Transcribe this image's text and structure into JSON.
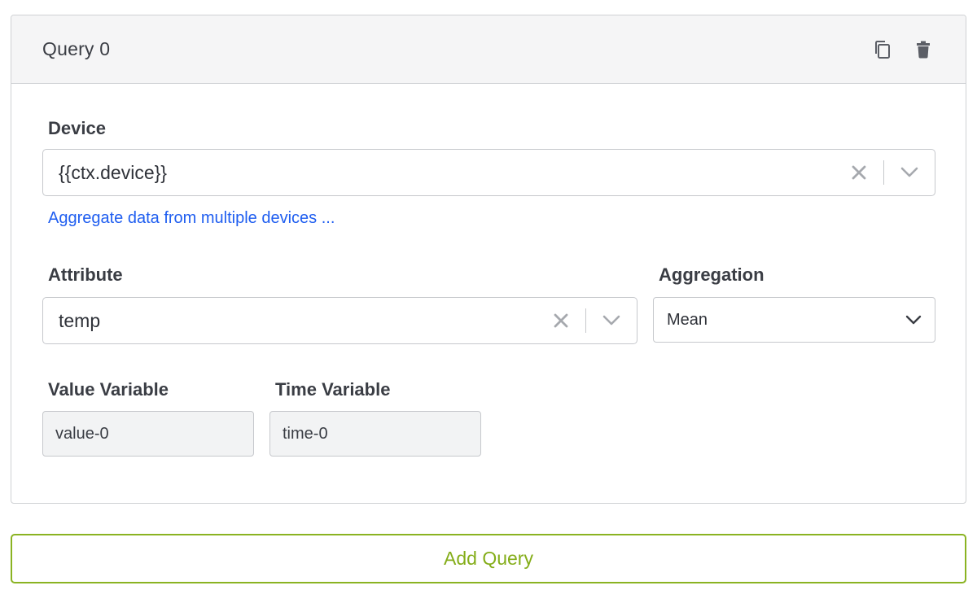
{
  "query": {
    "title": "Query 0",
    "actions": {
      "duplicate_icon": "copy-icon",
      "delete_icon": "trash-icon"
    },
    "device": {
      "label": "Device",
      "value": "{{ctx.device}}",
      "aggregate_link": "Aggregate data from multiple devices ..."
    },
    "attribute": {
      "label": "Attribute",
      "value": "temp"
    },
    "aggregation": {
      "label": "Aggregation",
      "value": "Mean"
    },
    "value_variable": {
      "label": "Value Variable",
      "value": "value-0"
    },
    "time_variable": {
      "label": "Time Variable",
      "value": "time-0"
    }
  },
  "add_query_label": "Add Query",
  "colors": {
    "accent_green": "#84ad19",
    "link_blue": "#1f5ef0",
    "header_bg": "#f5f5f6",
    "border": "#cfd1d4"
  }
}
